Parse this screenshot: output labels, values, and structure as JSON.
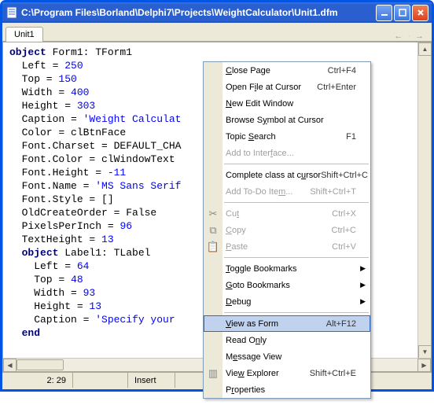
{
  "window": {
    "title": "C:\\Program Files\\Borland\\Delphi7\\Projects\\WeightCalculator\\Unit1.dfm"
  },
  "tabs": [
    {
      "label": "Unit1"
    }
  ],
  "editor": {
    "lines_html": "<span class=\"kw\">object</span> Form1: TForm1\n  Left = <span class=\"num\">250</span>\n  Top = <span class=\"num\">150</span>\n  Width = <span class=\"num\">400</span>\n  Height = <span class=\"num\">303</span>\n  Caption = <span class=\"str\">'Weight Calculat</span>\n  Color = clBtnFace\n  Font.Charset = DEFAULT_CHA\n  Font.Color = clWindowText\n  Font.Height = <span class=\"num\">-11</span>\n  Font.Name = <span class=\"str\">'MS Sans Serif</span>\n  Font.Style = []\n  OldCreateOrder = False\n  PixelsPerInch = <span class=\"num\">96</span>\n  TextHeight = <span class=\"num\">13</span>\n  <span class=\"kw\">object</span> Label1: TLabel\n    Left = <span class=\"num\">64</span>\n    Top = <span class=\"num\">48</span>\n    Width = <span class=\"num\">93</span>\n    Height = <span class=\"num\">13</span>\n    Caption = <span class=\"str\">'Specify your </span>\n  <span class=\"kw\">end</span>"
  },
  "status": {
    "pos": "2: 29",
    "modified": "",
    "insert": "Insert"
  },
  "menu": {
    "items": [
      {
        "kind": "item",
        "label_html": "<span class=\"ul\">C</span>lose Page",
        "shortcut": "Ctrl+F4",
        "enabled": true
      },
      {
        "kind": "item",
        "label_html": "Open F<span class=\"ul\">i</span>le at Cursor",
        "shortcut": "Ctrl+Enter",
        "enabled": true
      },
      {
        "kind": "item",
        "label_html": "<span class=\"ul\">N</span>ew Edit Window",
        "shortcut": "",
        "enabled": true
      },
      {
        "kind": "item",
        "label_html": "Browse S<span class=\"ul\">y</span>mbol at Cursor",
        "shortcut": "",
        "enabled": true
      },
      {
        "kind": "item",
        "label_html": "Topic <span class=\"ul\">S</span>earch",
        "shortcut": "F1",
        "enabled": true
      },
      {
        "kind": "item",
        "label_html": "Add to Inter<span class=\"ul\">f</span>ace...",
        "shortcut": "",
        "enabled": false
      },
      {
        "kind": "sep"
      },
      {
        "kind": "item",
        "label_html": "Complete class at c<span class=\"ul\">u</span>rsor",
        "shortcut": "Shift+Ctrl+C",
        "enabled": true
      },
      {
        "kind": "item",
        "label_html": "Add To-Do Ite<span class=\"ul\">m</span>...",
        "shortcut": "Shift+Ctrl+T",
        "enabled": false
      },
      {
        "kind": "sep"
      },
      {
        "kind": "item",
        "label_html": "Cu<span class=\"ul\">t</span>",
        "shortcut": "Ctrl+X",
        "enabled": false,
        "icon": "✂"
      },
      {
        "kind": "item",
        "label_html": "<span class=\"ul\">C</span>opy",
        "shortcut": "Ctrl+C",
        "enabled": false,
        "icon": "⧉"
      },
      {
        "kind": "item",
        "label_html": "<span class=\"ul\">P</span>aste",
        "shortcut": "Ctrl+V",
        "enabled": false,
        "icon": "📋"
      },
      {
        "kind": "sep"
      },
      {
        "kind": "item",
        "label_html": "<span class=\"ul\">T</span>oggle Bookmarks",
        "shortcut": "",
        "enabled": true,
        "submenu": true
      },
      {
        "kind": "item",
        "label_html": "<span class=\"ul\">G</span>oto Bookmarks",
        "shortcut": "",
        "enabled": true,
        "submenu": true
      },
      {
        "kind": "item",
        "label_html": "<span class=\"ul\">D</span>ebug",
        "shortcut": "",
        "enabled": true,
        "submenu": true
      },
      {
        "kind": "sep"
      },
      {
        "kind": "item",
        "label_html": "<span class=\"ul\">V</span>iew as Form",
        "shortcut": "Alt+F12",
        "enabled": true,
        "highlight": true
      },
      {
        "kind": "item",
        "label_html": "Read O<span class=\"ul\">n</span>ly",
        "shortcut": "",
        "enabled": true
      },
      {
        "kind": "item",
        "label_html": "M<span class=\"ul\">e</span>ssage View",
        "shortcut": "",
        "enabled": true
      },
      {
        "kind": "item",
        "label_html": "Vie<span class=\"ul\">w</span> Explorer",
        "shortcut": "Shift+Ctrl+E",
        "enabled": true,
        "icon": "▥"
      },
      {
        "kind": "item",
        "label_html": "P<span class=\"ul\">r</span>operties",
        "shortcut": "",
        "enabled": true
      }
    ]
  }
}
